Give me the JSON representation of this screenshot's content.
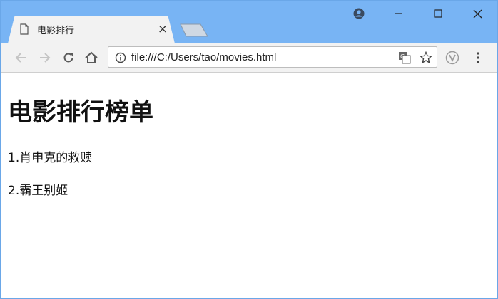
{
  "tab": {
    "title": "电影排行",
    "close_label": "×",
    "favicon": "document-icon"
  },
  "omnibox": {
    "url": "file:///C:/Users/tao/movies.html"
  },
  "page": {
    "heading": "电影排行榜单",
    "items": [
      "1.肖申克的救赎",
      "2.霸王别姬"
    ]
  },
  "colors": {
    "titlebar": "#78b4f4",
    "toolbar": "#f2f2f2",
    "frame": "#6aa7e8"
  }
}
